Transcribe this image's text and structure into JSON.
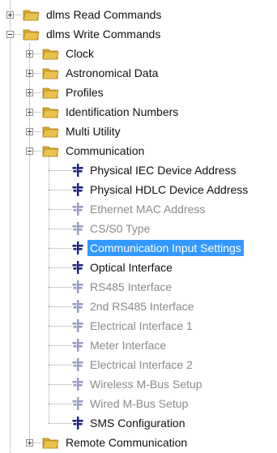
{
  "colors": {
    "selection": "#3399ff",
    "disabled_text": "#8a8a8a",
    "folder": "#e8c24a",
    "leaf_icon": "#1a237e"
  },
  "tree": {
    "root_items": [
      {
        "label": "dlms Read Commands",
        "icon": "folder-icon",
        "state": "collapsed"
      },
      {
        "label": "dlms Write Commands",
        "icon": "folder-icon",
        "state": "expanded"
      }
    ],
    "write_children": [
      {
        "label": "Clock",
        "icon": "folder-icon",
        "state": "collapsed"
      },
      {
        "label": "Astronomical Data",
        "icon": "folder-icon",
        "state": "collapsed"
      },
      {
        "label": "Profiles",
        "icon": "folder-icon",
        "state": "collapsed"
      },
      {
        "label": "Identification Numbers",
        "icon": "folder-icon",
        "state": "collapsed"
      },
      {
        "label": "Multi Utility",
        "icon": "folder-icon",
        "state": "collapsed"
      },
      {
        "label": "Communication",
        "icon": "folder-icon",
        "state": "expanded"
      }
    ],
    "communication_children": [
      {
        "label": "Physical IEC Device Address",
        "icon": "command-icon",
        "enabled": true
      },
      {
        "label": "Physical HDLC Device Address",
        "icon": "command-icon",
        "enabled": true
      },
      {
        "label": "Ethernet MAC Address",
        "icon": "command-icon",
        "enabled": false
      },
      {
        "label": "CS/S0 Type",
        "icon": "command-icon",
        "enabled": false
      },
      {
        "label": "Communication Input Settings",
        "icon": "command-icon",
        "enabled": true,
        "selected": true
      },
      {
        "label": "Optical Interface",
        "icon": "command-icon",
        "enabled": true
      },
      {
        "label": "RS485 Interface",
        "icon": "command-icon",
        "enabled": false
      },
      {
        "label": "2nd RS485 Interface",
        "icon": "command-icon",
        "enabled": false
      },
      {
        "label": "Electrical Interface 1",
        "icon": "command-icon",
        "enabled": false
      },
      {
        "label": "Meter Interface",
        "icon": "command-icon",
        "enabled": false
      },
      {
        "label": "Electrical Interface 2",
        "icon": "command-icon",
        "enabled": false
      },
      {
        "label": "Wireless M-Bus Setup",
        "icon": "command-icon",
        "enabled": false
      },
      {
        "label": "Wired M-Bus Setup",
        "icon": "command-icon",
        "enabled": false
      },
      {
        "label": "SMS Configuration",
        "icon": "command-icon",
        "enabled": true
      }
    ],
    "after_communication": [
      {
        "label": "Remote Communication",
        "icon": "folder-icon",
        "state": "collapsed"
      }
    ]
  }
}
